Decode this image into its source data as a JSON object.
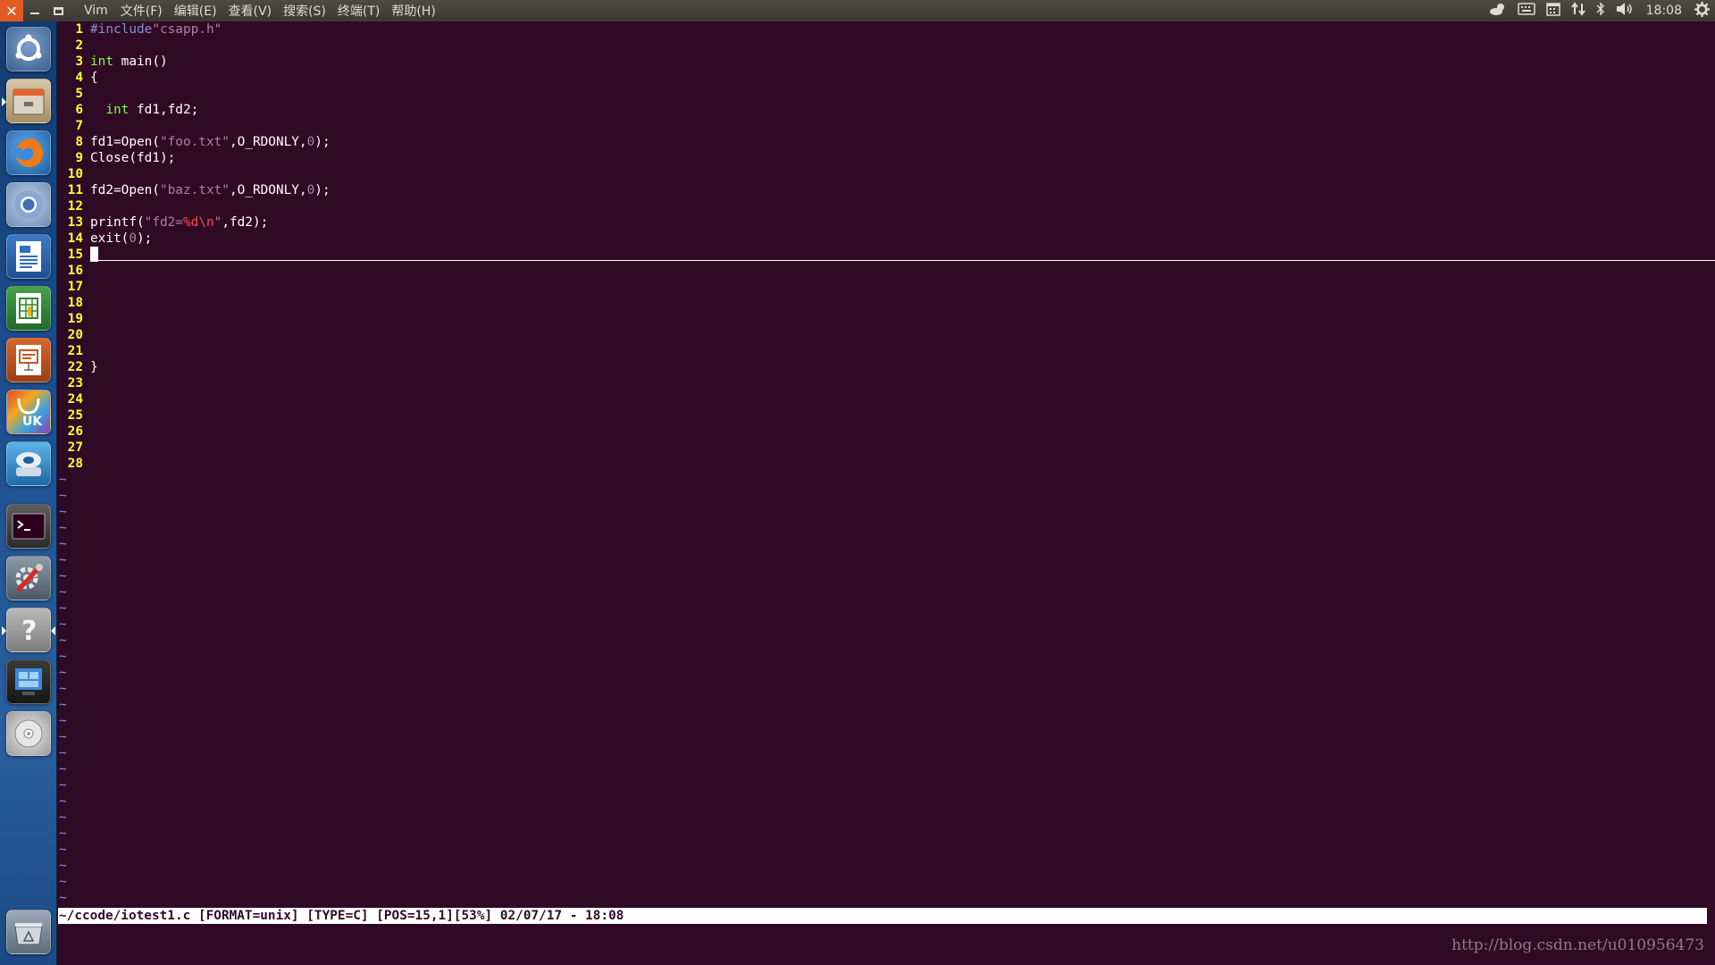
{
  "window": {
    "app_name": "Vim",
    "close_symbol": "✕",
    "menu": [
      "文件(F)",
      "编辑(E)",
      "查看(V)",
      "搜索(S)",
      "终端(T)",
      "帮助(H)"
    ]
  },
  "indicators": {
    "clock": "18:08",
    "icons": [
      "weather-icon",
      "keyboard-icon",
      "calendar-icon",
      "network-icon",
      "bluetooth-icon",
      "volume-icon",
      "settings-gear-icon"
    ]
  },
  "launcher": {
    "items": [
      "ubuntu-dash",
      "files",
      "firefox",
      "chromium",
      "libreoffice-writer",
      "libreoffice-calc",
      "libreoffice-impress",
      "ubuntu-software-center",
      "system-backup",
      "terminal",
      "system-settings",
      "help",
      "workspace-switcher",
      "dvd-drive",
      "trash"
    ]
  },
  "editor": {
    "lines": [
      {
        "n": "1",
        "text": "#include\"csapp.h\""
      },
      {
        "n": "2",
        "text": ""
      },
      {
        "n": "3",
        "text": "int main()"
      },
      {
        "n": "4",
        "text": "{"
      },
      {
        "n": "5",
        "text": ""
      },
      {
        "n": "6",
        "text": "  int fd1,fd2;"
      },
      {
        "n": "7",
        "text": ""
      },
      {
        "n": "8",
        "text": "fd1=Open(\"foo.txt\",O_RDONLY,0);"
      },
      {
        "n": "9",
        "text": "Close(fd1);"
      },
      {
        "n": "10",
        "text": ""
      },
      {
        "n": "11",
        "text": "fd2=Open(\"baz.txt\",O_RDONLY,0);"
      },
      {
        "n": "12",
        "text": ""
      },
      {
        "n": "13",
        "text": "printf(\"fd2=%d\\n\",fd2);"
      },
      {
        "n": "14",
        "text": "exit(0);"
      },
      {
        "n": "15",
        "text": ""
      },
      {
        "n": "16",
        "text": ""
      },
      {
        "n": "17",
        "text": ""
      },
      {
        "n": "18",
        "text": ""
      },
      {
        "n": "19",
        "text": ""
      },
      {
        "n": "20",
        "text": ""
      },
      {
        "n": "21",
        "text": ""
      },
      {
        "n": "22",
        "text": "}"
      },
      {
        "n": "23",
        "text": ""
      },
      {
        "n": "24",
        "text": ""
      },
      {
        "n": "25",
        "text": ""
      },
      {
        "n": "26",
        "text": ""
      },
      {
        "n": "27",
        "text": ""
      },
      {
        "n": "28",
        "text": ""
      }
    ],
    "tilde_marker": "~",
    "tilde_count": 27,
    "cursor_line": 15
  },
  "statusline": "~/ccode/iotest1.c [FORMAT=unix] [TYPE=C] [POS=15,1][53%] 02/07/17 - 18:08",
  "watermark": "http://blog.csdn.net/u010956473",
  "colors": {
    "background": "#300a24",
    "line_number": "#ffff3c",
    "type_keyword": "#7cff4a",
    "preprocessor": "#7b95d8",
    "string": "#ad7fa8",
    "format_specifier": "#ff4848",
    "tilde": "#8a8aff"
  }
}
